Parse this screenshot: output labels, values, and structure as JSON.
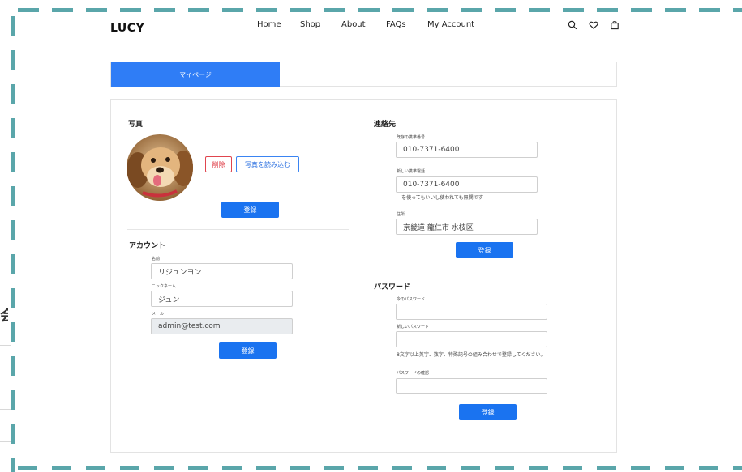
{
  "header": {
    "brand": "LUCY",
    "nav": [
      {
        "label": "Home"
      },
      {
        "label": "Shop"
      },
      {
        "label": "About"
      },
      {
        "label": "FAQs"
      },
      {
        "label": "My Account"
      }
    ],
    "icons": [
      "search-icon",
      "heart-icon",
      "bag-icon"
    ]
  },
  "tabs": {
    "active_label": "マイページ"
  },
  "photo": {
    "title": "写真",
    "delete_label": "削除",
    "upload_label": "写真を読み込む",
    "submit_label": "登録"
  },
  "account": {
    "title": "アカウント",
    "name_label": "名前",
    "name_value": "リジュンヨン",
    "nickname_label": "ニックネーム",
    "nickname_value": "ジュン",
    "email_label": "メール",
    "email_value": "admin@test.com",
    "submit_label": "登録"
  },
  "contact": {
    "title": "連絡先",
    "current_phone_label": "既存の携帯番号",
    "current_phone_value": "010-7371-6400",
    "new_phone_label": "新しい携帯電話",
    "new_phone_value": "010-7371-6400",
    "phone_hint": "- を使ってもいいし使われても無関です",
    "address_label": "住所",
    "address_value": "京畿道 龍仁市 水枝区",
    "submit_label": "登録"
  },
  "password": {
    "title": "パスワード",
    "current_label": "今のパスワード",
    "current_value": "",
    "new_label": "新しいパスワード",
    "new_value": "",
    "hint": "8文字以上英字、数字、特殊記号の組み合わせで登録してください。",
    "confirm_label": "パスワードの確認",
    "confirm_value": "",
    "submit_label": "登録"
  },
  "background": {
    "peek_text": "会員"
  },
  "colors": {
    "accent": "#1a73f0",
    "tab_active": "#2f7df6",
    "danger": "#e0454e",
    "nav_underline": "#c8302c",
    "dashed_overlay": "#5aa6aa"
  }
}
